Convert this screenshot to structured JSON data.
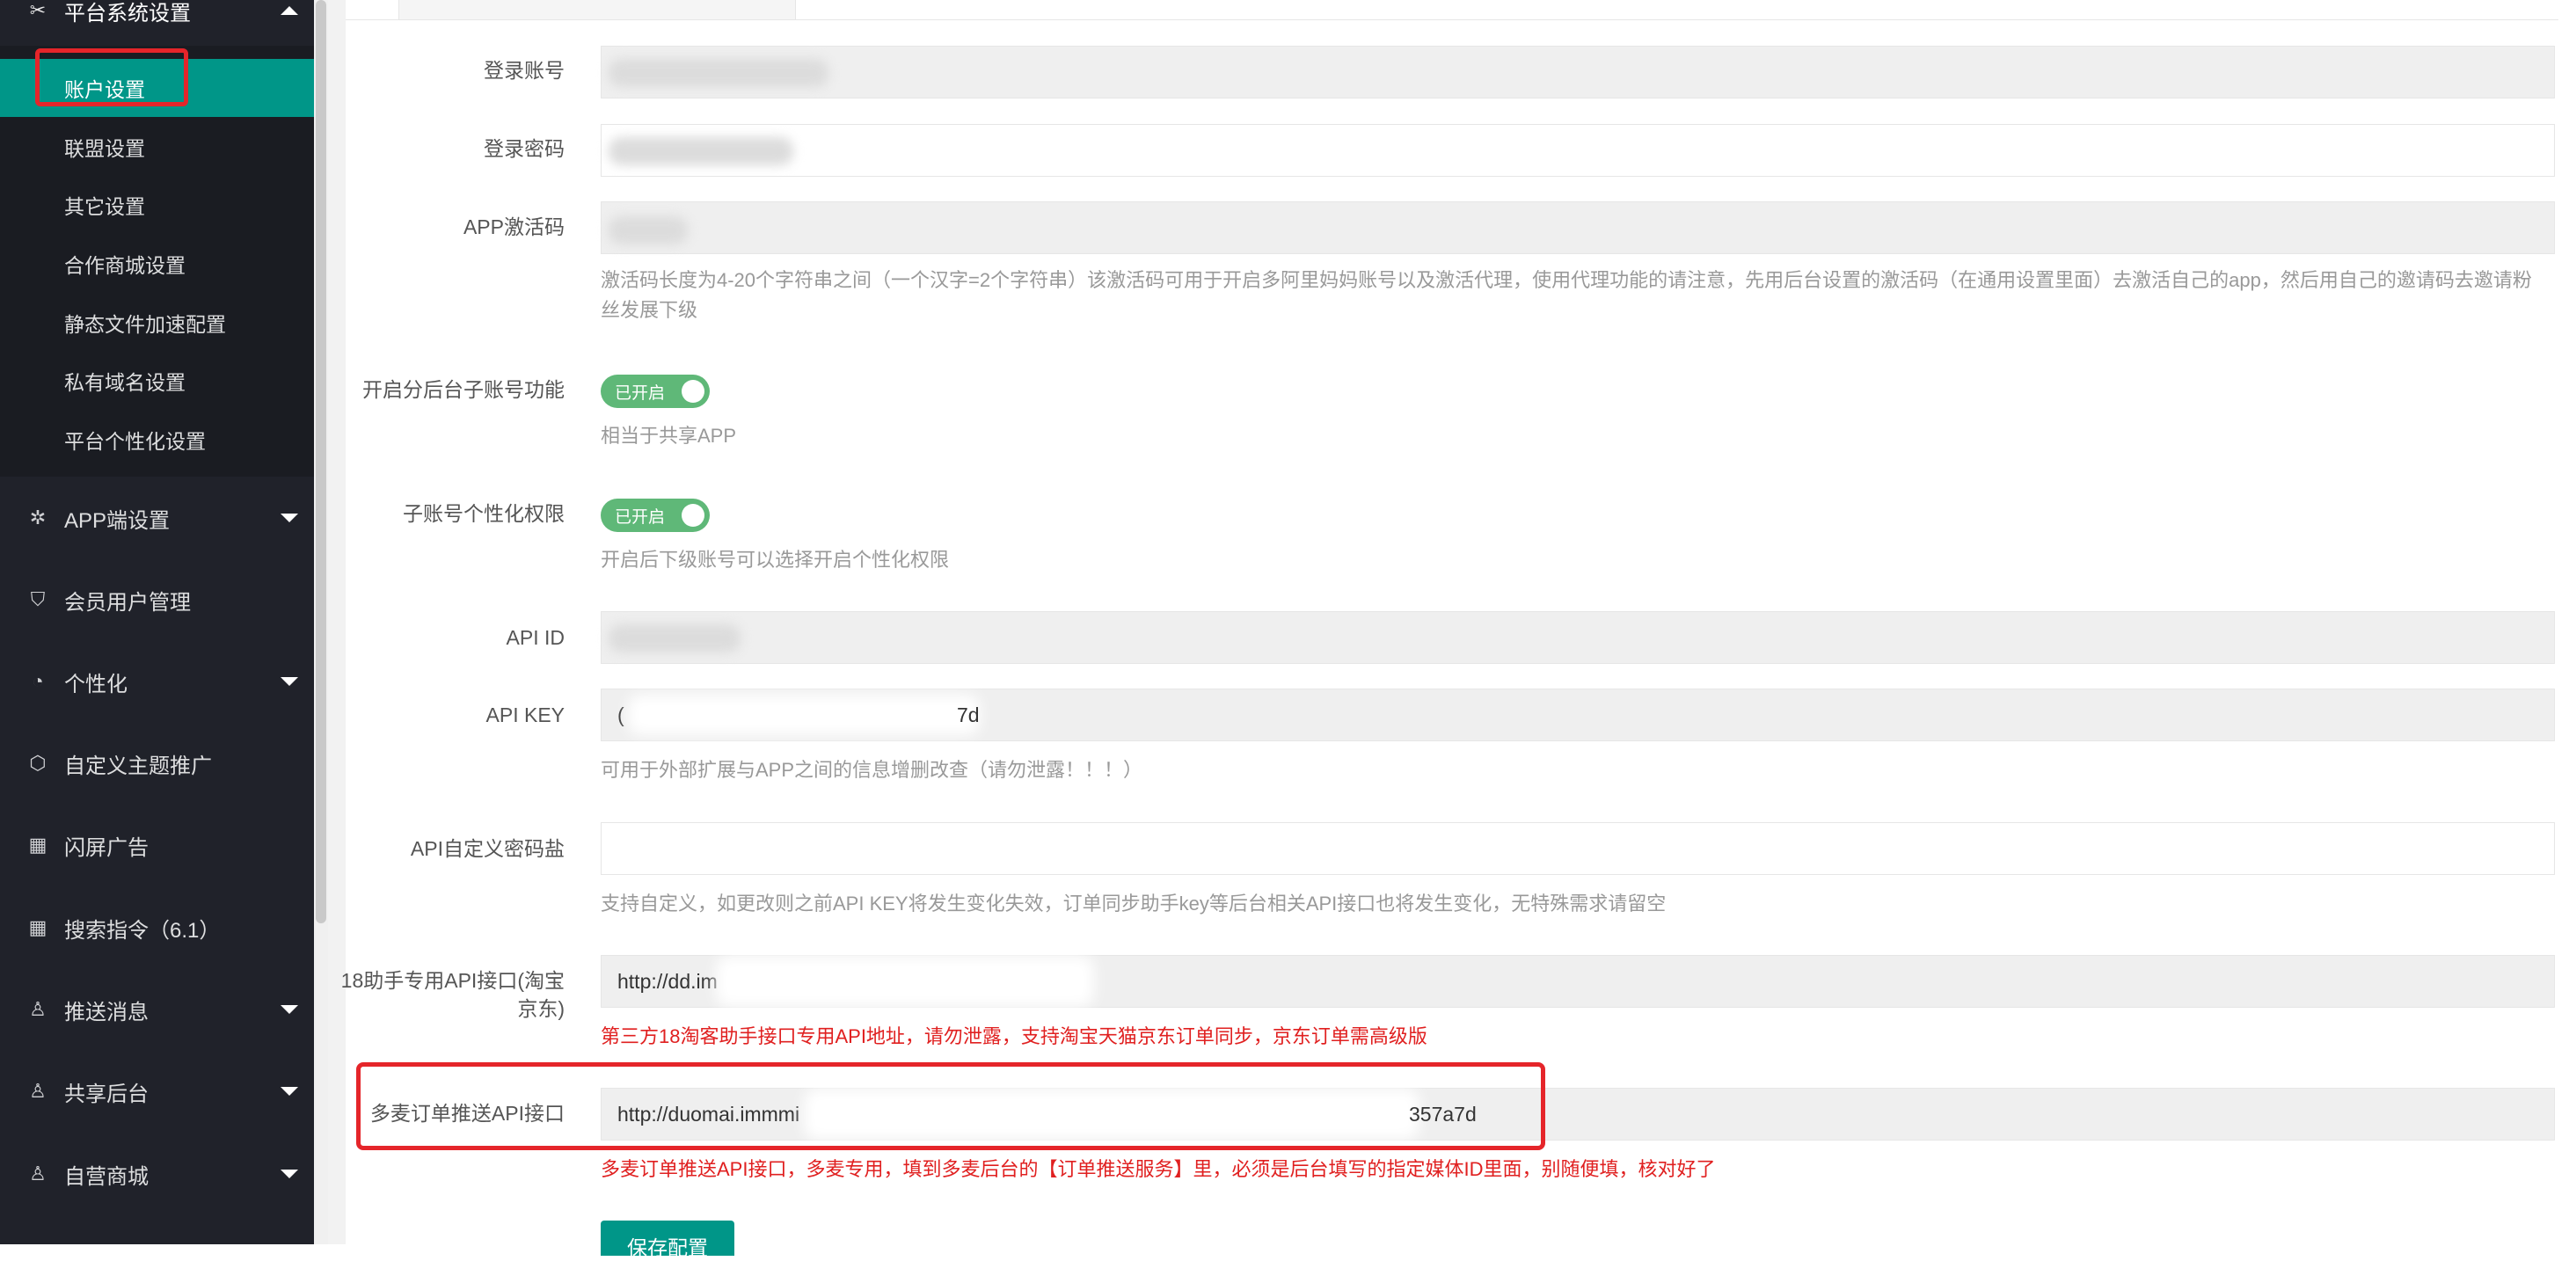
{
  "sidebar": {
    "group": {
      "label": "平台系统设置",
      "icon": "tools-icon"
    },
    "sub_items": [
      "账户设置",
      "联盟设置",
      "其它设置",
      "合作商城设置",
      "静态文件加速配置",
      "私有域名设置",
      "平台个性化设置"
    ],
    "items": [
      {
        "label": "APP端设置",
        "icon": "gear-icon"
      },
      {
        "label": "会员用户管理",
        "icon": "shield-icon"
      },
      {
        "label": "个性化",
        "icon": "palette-icon"
      },
      {
        "label": "自定义主题推广",
        "icon": "cube-icon"
      },
      {
        "label": "闪屏广告",
        "icon": "grid-icon"
      },
      {
        "label": "搜索指令（6.1）",
        "icon": "grid-icon"
      },
      {
        "label": "推送消息",
        "icon": "user-icon"
      },
      {
        "label": "共享后台",
        "icon": "user-icon"
      },
      {
        "label": "自营商城",
        "icon": "user-icon"
      }
    ]
  },
  "form": {
    "login_account": {
      "label": "登录账号"
    },
    "login_password": {
      "label": "登录密码"
    },
    "app_code": {
      "label": "APP激活码",
      "help": "激活码长度为4-20个字符串之间（一个汉字=2个字符串）该激活码可用于开启多阿里妈妈账号以及激活代理，使用代理功能的请注意，先用后台设置的激活码（在通用设置里面）去激活自己的app，然后用自己的邀请码去邀请粉丝发展下级"
    },
    "sub_account": {
      "label": "开启分后台子账号功能",
      "toggle": "已开启",
      "help": "相当于共享APP"
    },
    "sub_perm": {
      "label": "子账号个性化权限",
      "toggle": "已开启",
      "help": "开启后下级账号可以选择开启个性化权限"
    },
    "api_id": {
      "label": "API ID"
    },
    "api_key": {
      "label": "API KEY",
      "value_prefix": "(",
      "value_suffix": "7d",
      "help": "可用于外部扩展与APP之间的信息增删改查（请勿泄露！！！）"
    },
    "api_salt": {
      "label": "API自定义密码盐",
      "help": "支持自定义，如更改则之前API KEY将发生变化失效，订单同步助手key等后台相关API接口也将发生变化，无特殊需求请留空"
    },
    "api_18": {
      "label": "18助手专用API接口(淘宝京东)",
      "value": "http://dd.im",
      "help": "第三方18淘客助手接口专用API地址，请勿泄露，支持淘宝天猫京东订单同步，京东订单需高级版"
    },
    "duomai": {
      "label": "多麦订单推送API接口",
      "value": "http://duomai.immmi",
      "value_suffix": "357a7d",
      "help": "多麦订单推送API接口，多麦专用，填到多麦后台的【订单推送服务】里，必须是后台填写的指定媒体ID里面，别随便填，核对好了"
    },
    "save_label": "保存配置"
  }
}
